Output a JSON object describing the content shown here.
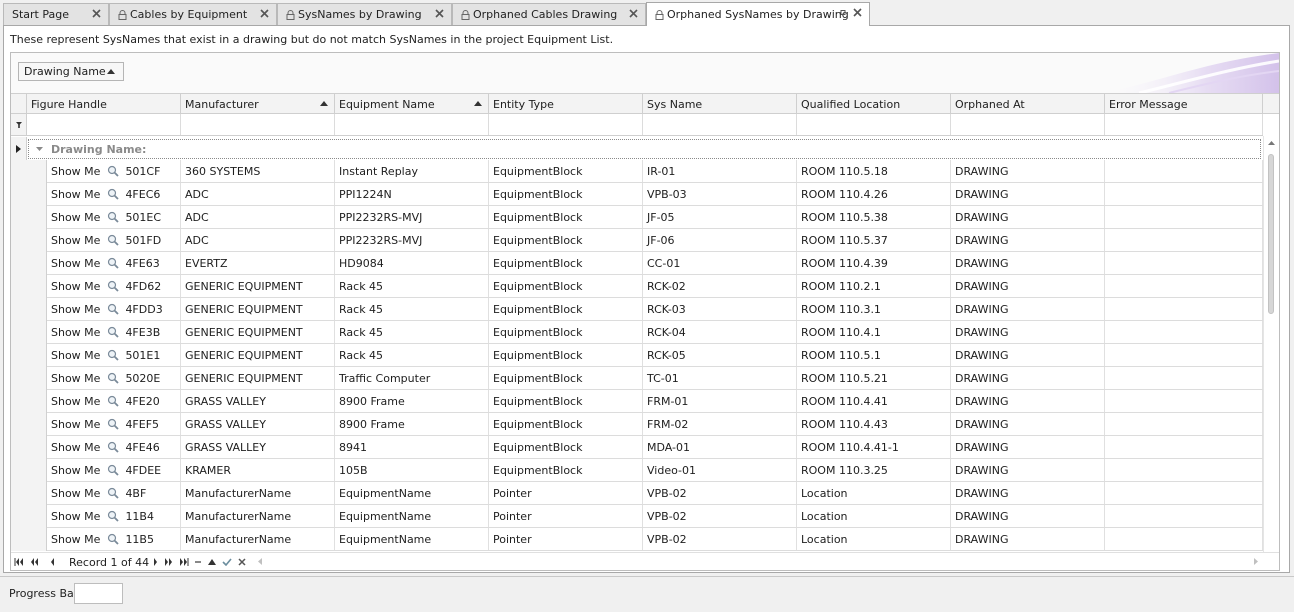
{
  "tabs": [
    {
      "label": "Start Page",
      "locked": false,
      "active": false
    },
    {
      "label": "Cables by Equipment",
      "locked": true,
      "active": false
    },
    {
      "label": "SysNames by Drawing",
      "locked": true,
      "active": false
    },
    {
      "label": "Orphaned Cables Drawing",
      "locked": true,
      "active": false
    },
    {
      "label": "Orphaned SysNames by Drawing",
      "locked": true,
      "active": true
    }
  ],
  "description": "These represent SysNames that exist in a drawing but do not match SysNames in the project Equipment List.",
  "group_chip": {
    "label": "Drawing Name",
    "sort": "ascending"
  },
  "columns": [
    {
      "label": "Figure Handle",
      "sort": ""
    },
    {
      "label": "Manufacturer",
      "sort": "ascending"
    },
    {
      "label": "Equipment Name",
      "sort": "ascending"
    },
    {
      "label": "Entity Type",
      "sort": ""
    },
    {
      "label": "Sys Name",
      "sort": ""
    },
    {
      "label": "Qualified Location",
      "sort": ""
    },
    {
      "label": "Orphaned At",
      "sort": ""
    },
    {
      "label": "Error Message",
      "sort": ""
    }
  ],
  "group_row": {
    "label": "Drawing Name:"
  },
  "show_me_label": "Show Me",
  "rows": [
    {
      "handle": "501CF",
      "manufacturer": "360 SYSTEMS",
      "equipment": "Instant Replay",
      "entity": "EquipmentBlock",
      "sysname": "IR-01",
      "location": "ROOM 110.5.18",
      "orphaned": "DRAWING",
      "error": ""
    },
    {
      "handle": "4FEC6",
      "manufacturer": "ADC",
      "equipment": "PPI1224N",
      "entity": "EquipmentBlock",
      "sysname": "VPB-03",
      "location": "ROOM 110.4.26",
      "orphaned": "DRAWING",
      "error": ""
    },
    {
      "handle": "501EC",
      "manufacturer": "ADC",
      "equipment": "PPI2232RS-MVJ",
      "entity": "EquipmentBlock",
      "sysname": "JF-05",
      "location": "ROOM 110.5.38",
      "orphaned": "DRAWING",
      "error": ""
    },
    {
      "handle": "501FD",
      "manufacturer": "ADC",
      "equipment": "PPI2232RS-MVJ",
      "entity": "EquipmentBlock",
      "sysname": "JF-06",
      "location": "ROOM 110.5.37",
      "orphaned": "DRAWING",
      "error": ""
    },
    {
      "handle": "4FE63",
      "manufacturer": "EVERTZ",
      "equipment": "HD9084",
      "entity": "EquipmentBlock",
      "sysname": "CC-01",
      "location": "ROOM 110.4.39",
      "orphaned": "DRAWING",
      "error": ""
    },
    {
      "handle": "4FD62",
      "manufacturer": "GENERIC EQUIPMENT",
      "equipment": "Rack 45",
      "entity": "EquipmentBlock",
      "sysname": "RCK-02",
      "location": "ROOM 110.2.1",
      "orphaned": "DRAWING",
      "error": ""
    },
    {
      "handle": "4FDD3",
      "manufacturer": "GENERIC EQUIPMENT",
      "equipment": "Rack 45",
      "entity": "EquipmentBlock",
      "sysname": "RCK-03",
      "location": "ROOM 110.3.1",
      "orphaned": "DRAWING",
      "error": ""
    },
    {
      "handle": "4FE3B",
      "manufacturer": "GENERIC EQUIPMENT",
      "equipment": "Rack 45",
      "entity": "EquipmentBlock",
      "sysname": "RCK-04",
      "location": "ROOM 110.4.1",
      "orphaned": "DRAWING",
      "error": ""
    },
    {
      "handle": "501E1",
      "manufacturer": "GENERIC EQUIPMENT",
      "equipment": "Rack 45",
      "entity": "EquipmentBlock",
      "sysname": "RCK-05",
      "location": "ROOM 110.5.1",
      "orphaned": "DRAWING",
      "error": ""
    },
    {
      "handle": "5020E",
      "manufacturer": "GENERIC EQUIPMENT",
      "equipment": "Traffic Computer",
      "entity": "EquipmentBlock",
      "sysname": "TC-01",
      "location": "ROOM 110.5.21",
      "orphaned": "DRAWING",
      "error": ""
    },
    {
      "handle": "4FE20",
      "manufacturer": "GRASS VALLEY",
      "equipment": "8900 Frame",
      "entity": "EquipmentBlock",
      "sysname": "FRM-01",
      "location": "ROOM 110.4.41",
      "orphaned": "DRAWING",
      "error": ""
    },
    {
      "handle": "4FEF5",
      "manufacturer": "GRASS VALLEY",
      "equipment": "8900 Frame",
      "entity": "EquipmentBlock",
      "sysname": "FRM-02",
      "location": "ROOM 110.4.43",
      "orphaned": "DRAWING",
      "error": ""
    },
    {
      "handle": "4FE46",
      "manufacturer": "GRASS VALLEY",
      "equipment": "8941",
      "entity": "EquipmentBlock",
      "sysname": "MDA-01",
      "location": "ROOM 110.4.41-1",
      "orphaned": "DRAWING",
      "error": ""
    },
    {
      "handle": "4FDEE",
      "manufacturer": "KRAMER",
      "equipment": "105B",
      "entity": "EquipmentBlock",
      "sysname": "Video-01",
      "location": "ROOM 110.3.25",
      "orphaned": "DRAWING",
      "error": ""
    },
    {
      "handle": "4BF",
      "manufacturer": "ManufacturerName",
      "equipment": "EquipmentName",
      "entity": "Pointer",
      "sysname": "VPB-02",
      "location": "Location",
      "orphaned": "DRAWING",
      "error": ""
    },
    {
      "handle": "11B4",
      "manufacturer": "ManufacturerName",
      "equipment": "EquipmentName",
      "entity": "Pointer",
      "sysname": "VPB-02",
      "location": "Location",
      "orphaned": "DRAWING",
      "error": ""
    },
    {
      "handle": "11B5",
      "manufacturer": "ManufacturerName",
      "equipment": "EquipmentName",
      "entity": "Pointer",
      "sysname": "VPB-02",
      "location": "Location",
      "orphaned": "DRAWING",
      "error": ""
    }
  ],
  "navigator": {
    "record_text": "Record 1 of 44"
  },
  "status": {
    "progress_label": "Progress Bar"
  },
  "colors": {
    "group_text": "#8a8a8a",
    "accent_swoosh": "#c9b3e6"
  },
  "icons": {
    "lock": "lock-icon",
    "close": "close-icon",
    "pin": "pin-icon",
    "sort": "sort-ascending-icon",
    "filter": "filter-icon",
    "magnifier": "magnifier-icon"
  }
}
